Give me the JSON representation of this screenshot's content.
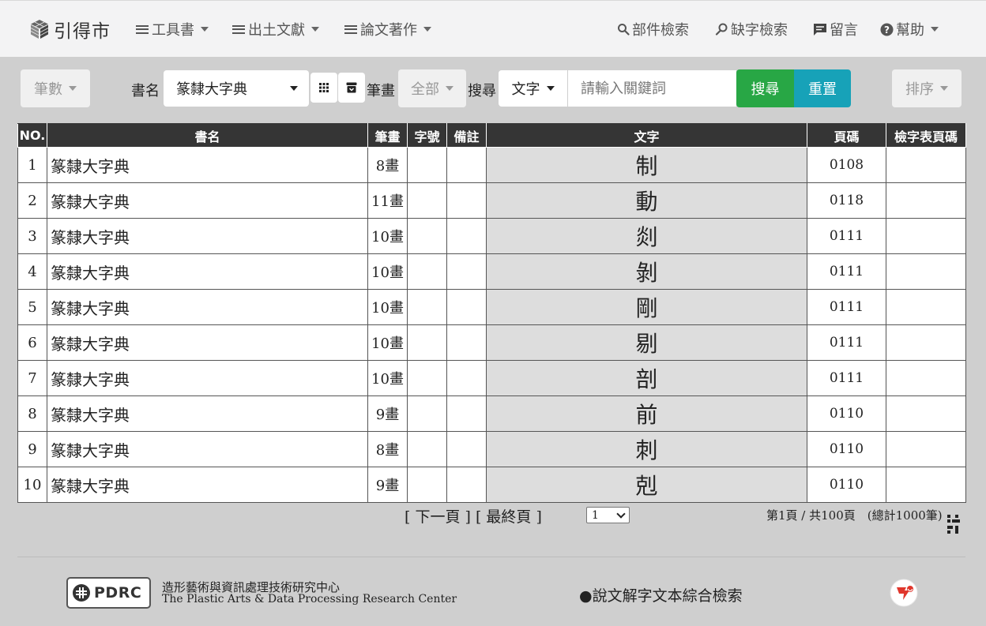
{
  "navbar": {
    "brand": "引得市",
    "menus": [
      {
        "label": "工具書"
      },
      {
        "label": "出土文獻"
      },
      {
        "label": "論文著作"
      }
    ],
    "right": {
      "part_search": "部件檢索",
      "missing_char_search": "缺字檢索",
      "message": "留言",
      "help": "幫助"
    }
  },
  "filters": {
    "strokes_btn": "筆數",
    "book_label": "書名",
    "book_value": "篆隸大字典",
    "stroke_label": "筆畫",
    "stroke_value": "全部",
    "search_label": "搜尋",
    "search_type": "文字",
    "search_placeholder": "請輸入關鍵詞",
    "search_btn": "搜尋",
    "reset_btn": "重置",
    "sort_btn": "排序"
  },
  "table": {
    "headers": [
      "NO.",
      "書名",
      "筆畫",
      "字號",
      "備註",
      "文字",
      "頁碼",
      "檢字表頁碼"
    ],
    "rows": [
      {
        "no": "1",
        "book": "篆隸大字典",
        "strokes": "8畫",
        "char_no": "",
        "note": "",
        "char": "制",
        "page": "0108",
        "index_page": ""
      },
      {
        "no": "2",
        "book": "篆隸大字典",
        "strokes": "11畫",
        "char_no": "",
        "note": "",
        "char": "動",
        "page": "0118",
        "index_page": ""
      },
      {
        "no": "3",
        "book": "篆隸大字典",
        "strokes": "10畫",
        "char_no": "",
        "note": "",
        "char": "剡",
        "page": "0111",
        "index_page": ""
      },
      {
        "no": "4",
        "book": "篆隸大字典",
        "strokes": "10畫",
        "char_no": "",
        "note": "",
        "char": "剝",
        "page": "0111",
        "index_page": ""
      },
      {
        "no": "5",
        "book": "篆隸大字典",
        "strokes": "10畫",
        "char_no": "",
        "note": "",
        "char": "剛",
        "page": "0111",
        "index_page": ""
      },
      {
        "no": "6",
        "book": "篆隸大字典",
        "strokes": "10畫",
        "char_no": "",
        "note": "",
        "char": "剔",
        "page": "0111",
        "index_page": ""
      },
      {
        "no": "7",
        "book": "篆隸大字典",
        "strokes": "10畫",
        "char_no": "",
        "note": "",
        "char": "剖",
        "page": "0111",
        "index_page": ""
      },
      {
        "no": "8",
        "book": "篆隸大字典",
        "strokes": "9畫",
        "char_no": "",
        "note": "",
        "char": "前",
        "page": "0110",
        "index_page": ""
      },
      {
        "no": "9",
        "book": "篆隸大字典",
        "strokes": "8畫",
        "char_no": "",
        "note": "",
        "char": "刺",
        "page": "0110",
        "index_page": ""
      },
      {
        "no": "10",
        "book": "篆隸大字典",
        "strokes": "9畫",
        "char_no": "",
        "note": "",
        "char": "剋",
        "page": "0110",
        "index_page": ""
      }
    ]
  },
  "pagination": {
    "next": "[ 下一頁 ]",
    "last": "[ 最終頁 ]",
    "current_page": "1",
    "info": "第1頁 / 共100頁　(總計1000筆)"
  },
  "footer": {
    "logo_text": "PDRC",
    "org_cn": "造形藝術與資訊處理技術研究中心",
    "org_en": "The Plastic Arts & Data Processing Research Center",
    "link": "●說文解字文本綜合檢索"
  }
}
